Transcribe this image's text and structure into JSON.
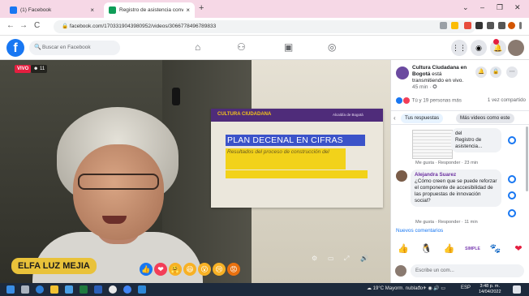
{
  "browser": {
    "tabs": [
      {
        "label": "(1) Facebook",
        "close": "×"
      },
      {
        "label": "Registro de asistencia conversat...",
        "close": "×"
      }
    ],
    "new_tab": "+",
    "window_controls": [
      "⌄",
      "–",
      "❐",
      "✕"
    ],
    "url": "facebook.com/1703319043980952/videos/3066778496789833",
    "nav": {
      "back": "←",
      "forward": "→",
      "reload": "C"
    }
  },
  "facebook": {
    "logo": "f",
    "search_placeholder": "Buscar en Facebook",
    "nav_icons": [
      "home-icon",
      "groups-icon",
      "watch-icon",
      "gaming-icon"
    ],
    "right_icons": [
      "grid-icon",
      "messenger-icon",
      "bell-icon"
    ]
  },
  "video": {
    "live_label": "VIVO",
    "viewers": "☻ 11",
    "speaker_name": "ELFA LUZ MEJIA",
    "slide": {
      "brand": "CULTURA CIUDADANA",
      "brand_right": "Alcaldía de Bogotá",
      "title": "PLAN DECENAL EN CIFRAS",
      "subtitle": "Resultados del proceso de construcción del"
    },
    "reactions": [
      "👍",
      "❤",
      "🤗",
      "😆",
      "😮",
      "😢",
      "😡"
    ],
    "controls": [
      "⚙",
      "▭",
      "⤢",
      "🔊"
    ]
  },
  "panel": {
    "page_name": "Cultura Ciudadana en Bogotá",
    "page_status": "está transmitiendo en vivo.",
    "page_time": "45 min · ✪",
    "stats_left": "Tú y 19 personas más",
    "stats_right": "1 vez compartido",
    "chips": [
      "Tus respuestas",
      "Más videos como este"
    ],
    "comments": [
      {
        "text_line1": "del",
        "text_line2": "Registro de",
        "text_line3": "asistencia...",
        "actions": "Me gusta · Responder · 23 min"
      },
      {
        "name": "Alejandra Suarez",
        "text": "¿Cómo creen que se puede reforzar el componente de accesibilidad de las propuestas de innovación social?",
        "actions": "Me gusta · Responder · 11 min"
      }
    ],
    "more_comments": "Nuevos comentarios",
    "write_placeholder": "Escribe un com...",
    "stickers": [
      "👍",
      "🐧",
      "👍",
      "SIMPLE",
      "🐾",
      "❤"
    ]
  },
  "taskbar": {
    "weather": "19°C Mayorm. nublado",
    "lang": "ESP",
    "time": "3:48 p. m.",
    "date": "14/04/2022"
  },
  "colors": {
    "fb_blue": "#1877f2",
    "slide_purple": "#4f2c7a",
    "slide_yellow": "#f2d21a",
    "slide_title_bg": "#3b53c9",
    "name_tag": "#e9c23a"
  }
}
